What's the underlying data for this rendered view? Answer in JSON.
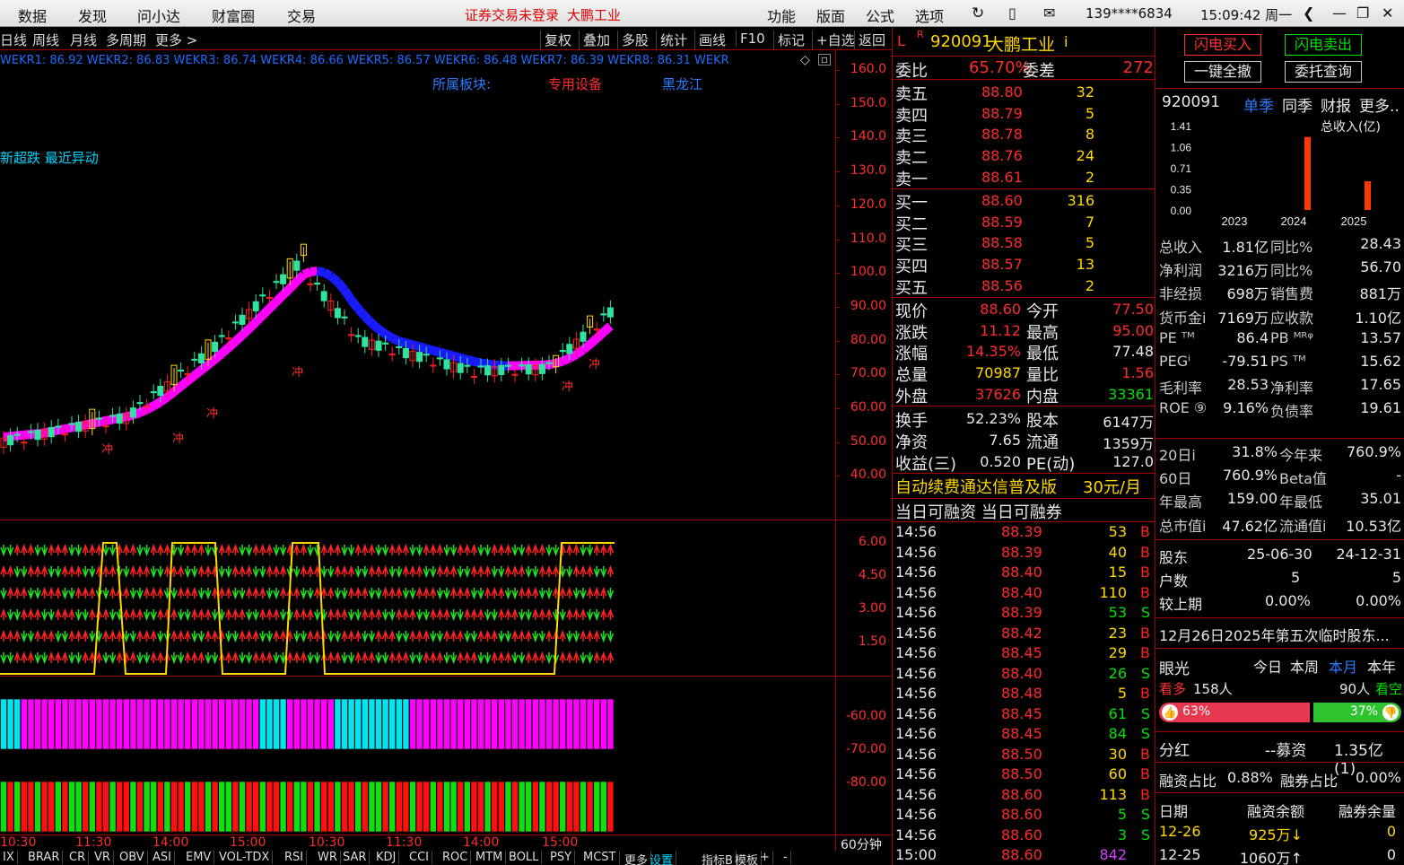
{
  "topbar": {
    "menu": [
      "数据",
      "发现",
      "问小达",
      "财富圈",
      "交易"
    ],
    "warning": "证券交易未登录",
    "stock_name": "大鹏工业",
    "right_menu": [
      "功能",
      "版面",
      "公式",
      "选项"
    ],
    "phone": "139****6834",
    "clock": "15:09:42 周一"
  },
  "toolbar": {
    "periods": [
      "日线",
      "周线",
      "月线",
      "多周期",
      "更多 >"
    ],
    "tools": [
      "复权",
      "叠加",
      "多股",
      "统计",
      "画线",
      "F10",
      "标记",
      "+自选",
      "返回"
    ]
  },
  "chart": {
    "wekr": "WEKR1: 86.92  WEKR2: 86.83  WEKR3: 86.74  WEKR4: 86.66  WEKR5: 86.57  WEKR6: 86.48  WEKR7: 86.39  WEKR8: 86.31  WEKR",
    "sector_label": "所属板块:",
    "sector": "专用设备",
    "region": "黑龙江",
    "alert": "新超跌 最近异动",
    "chong": "冲",
    "y_ticks": [
      "160.0",
      "150.0",
      "140.0",
      "130.0",
      "120.0",
      "110.0",
      "100.0",
      "90.00",
      "80.00",
      "70.00",
      "60.00",
      "50.00",
      "40.00"
    ],
    "ind1_ticks": [
      "6.00",
      "4.50",
      "3.00",
      "1.50"
    ],
    "ind2_ticks": [
      "-60.00",
      "-70.00",
      "-80.00"
    ],
    "time_ticks": [
      "10:30",
      "11:30",
      "14:00",
      "15:00",
      "10:30",
      "11:30",
      "14:00",
      "15:00"
    ],
    "period": "60分钟",
    "indicator_tabs": [
      "IX",
      "BRAR",
      "CR",
      "VR",
      "OBV",
      "ASI",
      "EMV",
      "VOL-TDX",
      "RSI",
      "WR",
      "SAR",
      "KDJ",
      "CCI",
      "ROC",
      "MTM",
      "BOLL",
      "PSY",
      "MCST",
      "更多",
      "设置",
      "指标B",
      "模板",
      "+",
      "-"
    ]
  },
  "quote": {
    "flag": "L",
    "r": "R",
    "code": "920091",
    "name": "大鹏工业",
    "i": "i",
    "wb_label": "委比",
    "wb": "65.70%",
    "wc_label": "委差",
    "wc": "272",
    "asks": [
      {
        "label": "卖五",
        "price": "88.80",
        "vol": "32"
      },
      {
        "label": "卖四",
        "price": "88.79",
        "vol": "5"
      },
      {
        "label": "卖三",
        "price": "88.78",
        "vol": "8"
      },
      {
        "label": "卖二",
        "price": "88.76",
        "vol": "24"
      },
      {
        "label": "卖一",
        "price": "88.61",
        "vol": "2"
      }
    ],
    "bids": [
      {
        "label": "买一",
        "price": "88.60",
        "vol": "316"
      },
      {
        "label": "买二",
        "price": "88.59",
        "vol": "7"
      },
      {
        "label": "买三",
        "price": "88.58",
        "vol": "5"
      },
      {
        "label": "买四",
        "price": "88.57",
        "vol": "13"
      },
      {
        "label": "买五",
        "price": "88.56",
        "vol": "2"
      }
    ],
    "stats": [
      {
        "l1": "现价",
        "v1": "88.60",
        "l2": "今开",
        "v2": "77.50"
      },
      {
        "l1": "涨跌",
        "v1": "11.12",
        "l2": "最高",
        "v2": "95.00"
      },
      {
        "l1": "涨幅",
        "v1": "14.35%",
        "l2": "最低",
        "v2": "77.48"
      },
      {
        "l1": "总量",
        "v1": "70987",
        "l2": "量比",
        "v2": "1.56"
      },
      {
        "l1": "外盘",
        "v1": "37626",
        "l2": "内盘",
        "v2": "33361"
      }
    ],
    "stats2": [
      {
        "l1": "换手",
        "v1": "52.23%",
        "l2": "股本",
        "v2": "6147万"
      },
      {
        "l1": "净资",
        "v1": "7.65",
        "l2": "流通",
        "v2": "1359万"
      },
      {
        "l1": "收益(三)",
        "v1": "0.520",
        "l2": "PE(动)",
        "v2": "127.0"
      }
    ],
    "ad": "自动续费通达信普及版",
    "ad_price": "30元/月",
    "margin": "当日可融资 当日可融券"
  },
  "ticks": [
    [
      "14:56",
      "88.39",
      "53",
      "B"
    ],
    [
      "14:56",
      "88.39",
      "40",
      "B"
    ],
    [
      "14:56",
      "88.40",
      "15",
      "B"
    ],
    [
      "14:56",
      "88.40",
      "110",
      "B"
    ],
    [
      "14:56",
      "88.39",
      "53",
      "S"
    ],
    [
      "14:56",
      "88.42",
      "23",
      "B"
    ],
    [
      "14:56",
      "88.45",
      "29",
      "B"
    ],
    [
      "14:56",
      "88.40",
      "26",
      "S"
    ],
    [
      "14:56",
      "88.48",
      "5",
      "B"
    ],
    [
      "14:56",
      "88.45",
      "61",
      "S"
    ],
    [
      "14:56",
      "88.45",
      "84",
      "S"
    ],
    [
      "14:56",
      "88.50",
      "30",
      "B"
    ],
    [
      "14:56",
      "88.50",
      "60",
      "B"
    ],
    [
      "14:56",
      "88.60",
      "113",
      "B"
    ],
    [
      "14:56",
      "88.60",
      "5",
      "S"
    ],
    [
      "14:56",
      "88.60",
      "3",
      "S"
    ],
    [
      "15:00",
      "88.60",
      "842",
      ""
    ]
  ],
  "right": {
    "buy_btn": "闪电买入",
    "sell_btn": "闪电卖出",
    "cancel_btn": "一键全撤",
    "query_btn": "委托查询",
    "code": "920091",
    "tabs": [
      "单季",
      "同季",
      "财报",
      "更多.."
    ],
    "chart_title": "总收入(亿)",
    "chart_data": {
      "type": "bar",
      "categories": [
        "2023",
        "2024",
        "2025"
      ],
      "values": [
        0,
        1.22,
        0.48
      ],
      "ylim": [
        0,
        1.41
      ],
      "yticks": [
        "1.41",
        "1.06",
        "0.71",
        "0.35",
        "0.00"
      ]
    },
    "fin": [
      [
        "总收入",
        "1.81亿",
        "同比%",
        "28.43"
      ],
      [
        "净利润",
        "3216万",
        "同比%",
        "56.70"
      ],
      [
        "非经损",
        "698万",
        "销售费",
        "881万"
      ],
      [
        "货币金i",
        "7169万",
        "应收款",
        "1.10亿"
      ],
      [
        "PE ᵀᴹ",
        "86.4",
        "PB ᴹᴿᵠ",
        "13.57"
      ],
      [
        "PEGⁱ",
        "-79.51",
        "PS ᵀᴹ",
        "15.62"
      ],
      [
        "毛利率",
        "28.53",
        "净利率",
        "17.65"
      ],
      [
        "ROE ⑨",
        "9.16%",
        "负债率",
        "19.61"
      ]
    ],
    "perf": [
      [
        "20日i",
        "31.8%",
        "今年来",
        "760.9%"
      ],
      [
        "60日",
        "760.9%",
        "Beta值",
        "-"
      ],
      [
        "年最高",
        "159.00",
        "年最低",
        "35.01"
      ],
      [
        "总市值i",
        "47.62亿",
        "流通值i",
        "10.53亿"
      ]
    ],
    "holders_label": "股东",
    "holders_d1": "25-06-30",
    "holders_d2": "24-12-31",
    "hu_label": "户数",
    "hu1": "5",
    "hu2": "5",
    "chg_label": "较上期",
    "chg1": "0.00%",
    "chg2": "0.00%",
    "notice": "12月26日2025年第五次临时股东...",
    "yanguang": "眼光",
    "periods": [
      "今日",
      "本周",
      "本月",
      "本年"
    ],
    "bull_label": "看多",
    "bull_count": "158人",
    "bear_count": "90人",
    "bear_label": "看空",
    "bull_pct": "63%",
    "bear_pct": "37%",
    "bull_frac": 0.63,
    "dividend_label": "分红",
    "dividend": "--募资",
    "raise": "1.35亿(1)",
    "rz_label": "融资占比",
    "rz": "0.88%",
    "rq_label": "融券占比",
    "rq": "0.00%",
    "date_label": "日期",
    "rz_bal": "融资余额",
    "rq_bal": "融券余量",
    "margin_rows": [
      [
        "12-26",
        "925万↓",
        "0"
      ],
      [
        "12-25",
        "1060万↑",
        "0"
      ]
    ]
  }
}
